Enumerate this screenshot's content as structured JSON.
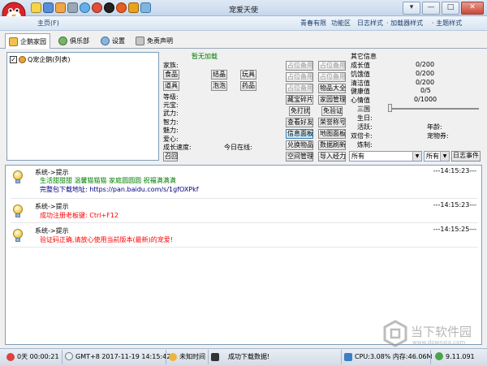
{
  "window": {
    "title": "宠爱天使",
    "buttons": {
      "menu": "▾",
      "minimize": "—",
      "maximize": "□",
      "close": "✕"
    }
  },
  "toolbar_icons": [
    "bulb-icon",
    "music-icon",
    "gift-icon",
    "wrench-icon",
    "globe-icon",
    "help-icon",
    "qq-icon",
    "settings-icon",
    "home-icon",
    "more-icon"
  ],
  "menubar": {
    "home": "主页(F)",
    "items": [
      "青春有限",
      "功能区",
      "日志样式",
      "加载器样式",
      "主题样式"
    ]
  },
  "tabs": [
    "企鹅家园",
    "俱乐部",
    "设置",
    "免责声明"
  ],
  "tree": {
    "root_label": "Q宠企鹅(列表)",
    "checked": true
  },
  "pet": {
    "status": "暂无加载",
    "kind_label": "家族:",
    "items": [
      "食品",
      "结晶",
      "玩具",
      "道具",
      "泡泡",
      "药品"
    ],
    "stats": [
      "等级:",
      "元宝:",
      "武力:",
      "智力:",
      "魅力:",
      "爱心:",
      "成长速度:"
    ],
    "online_label": "今日在线:",
    "summon_button": "召回"
  },
  "actions": {
    "placeholder": "占位备用",
    "rows": [
      [
        "占位备用",
        "占位备用"
      ],
      [
        "占位备用",
        "占位备用"
      ],
      [
        "占位备用",
        "物品大全"
      ],
      [
        "藏宝碎片",
        "家园管理"
      ],
      [
        "免打扰",
        "免验证"
      ],
      [
        "查看好友",
        "荣誉称号"
      ],
      [
        "信息面板",
        "地图面板"
      ],
      [
        "兑换物品",
        "数据刷新"
      ],
      [
        "空间管理",
        "导入经力"
      ]
    ]
  },
  "info": {
    "header": "其它信息",
    "rows": [
      {
        "label": "成长值",
        "value": "0/200"
      },
      {
        "label": "饥饿值",
        "value": "0/200"
      },
      {
        "label": "清洁值",
        "value": "0/200"
      },
      {
        "label": "健康值",
        "value": "0/5"
      },
      {
        "label": "心情值",
        "value": "0/1000"
      }
    ],
    "slider_label": "三国",
    "slider_value": 0,
    "fields": [
      "生日:",
      "活跃:",
      "双倍卡:",
      "炼制:"
    ],
    "age_label": "年龄:",
    "pet_coin_label": "宠物券:",
    "select_all": "所有",
    "select_all2": "所有",
    "daily_button": "日志事件"
  },
  "log": [
    {
      "header": "系统->提示",
      "time": "---14:15:23---",
      "lines": [
        {
          "text": "生活甜甜甜 温馨猫猫猫 家庭圆圆圆 祝福满满满",
          "color": "#008000"
        },
        {
          "text": "完整包下载地址: https://pan.baidu.com/s/1gfOXPkf",
          "color": "#000080"
        }
      ]
    },
    {
      "header": "系统->提示",
      "time": "---14:15:23---",
      "lines": [
        {
          "text": "成功注册老板键: Ctrl+F12",
          "color": "#ff0000"
        }
      ]
    },
    {
      "header": "系统->提示",
      "time": "---14:15:25---",
      "lines": [
        {
          "text": "验证码正确,请放心使用当前版本(最新)的宠爱!",
          "color": "#ff0000"
        }
      ]
    }
  ],
  "statusbar": {
    "uptime": "0天 00:00:21",
    "datetime": "GMT+8 2017-11-19 14:15:42",
    "sync": "未知时间",
    "message": "成功下载数据!",
    "cpu": "CPU:3.08% 内存:46.06M",
    "version": "9.11.091"
  },
  "watermark": {
    "text": "当下软件园",
    "sub": "www.downxia.com"
  },
  "colors": {
    "accent": "#1c3f70",
    "log_green": "#008000",
    "log_red": "#ff0000",
    "link": "#000080"
  }
}
